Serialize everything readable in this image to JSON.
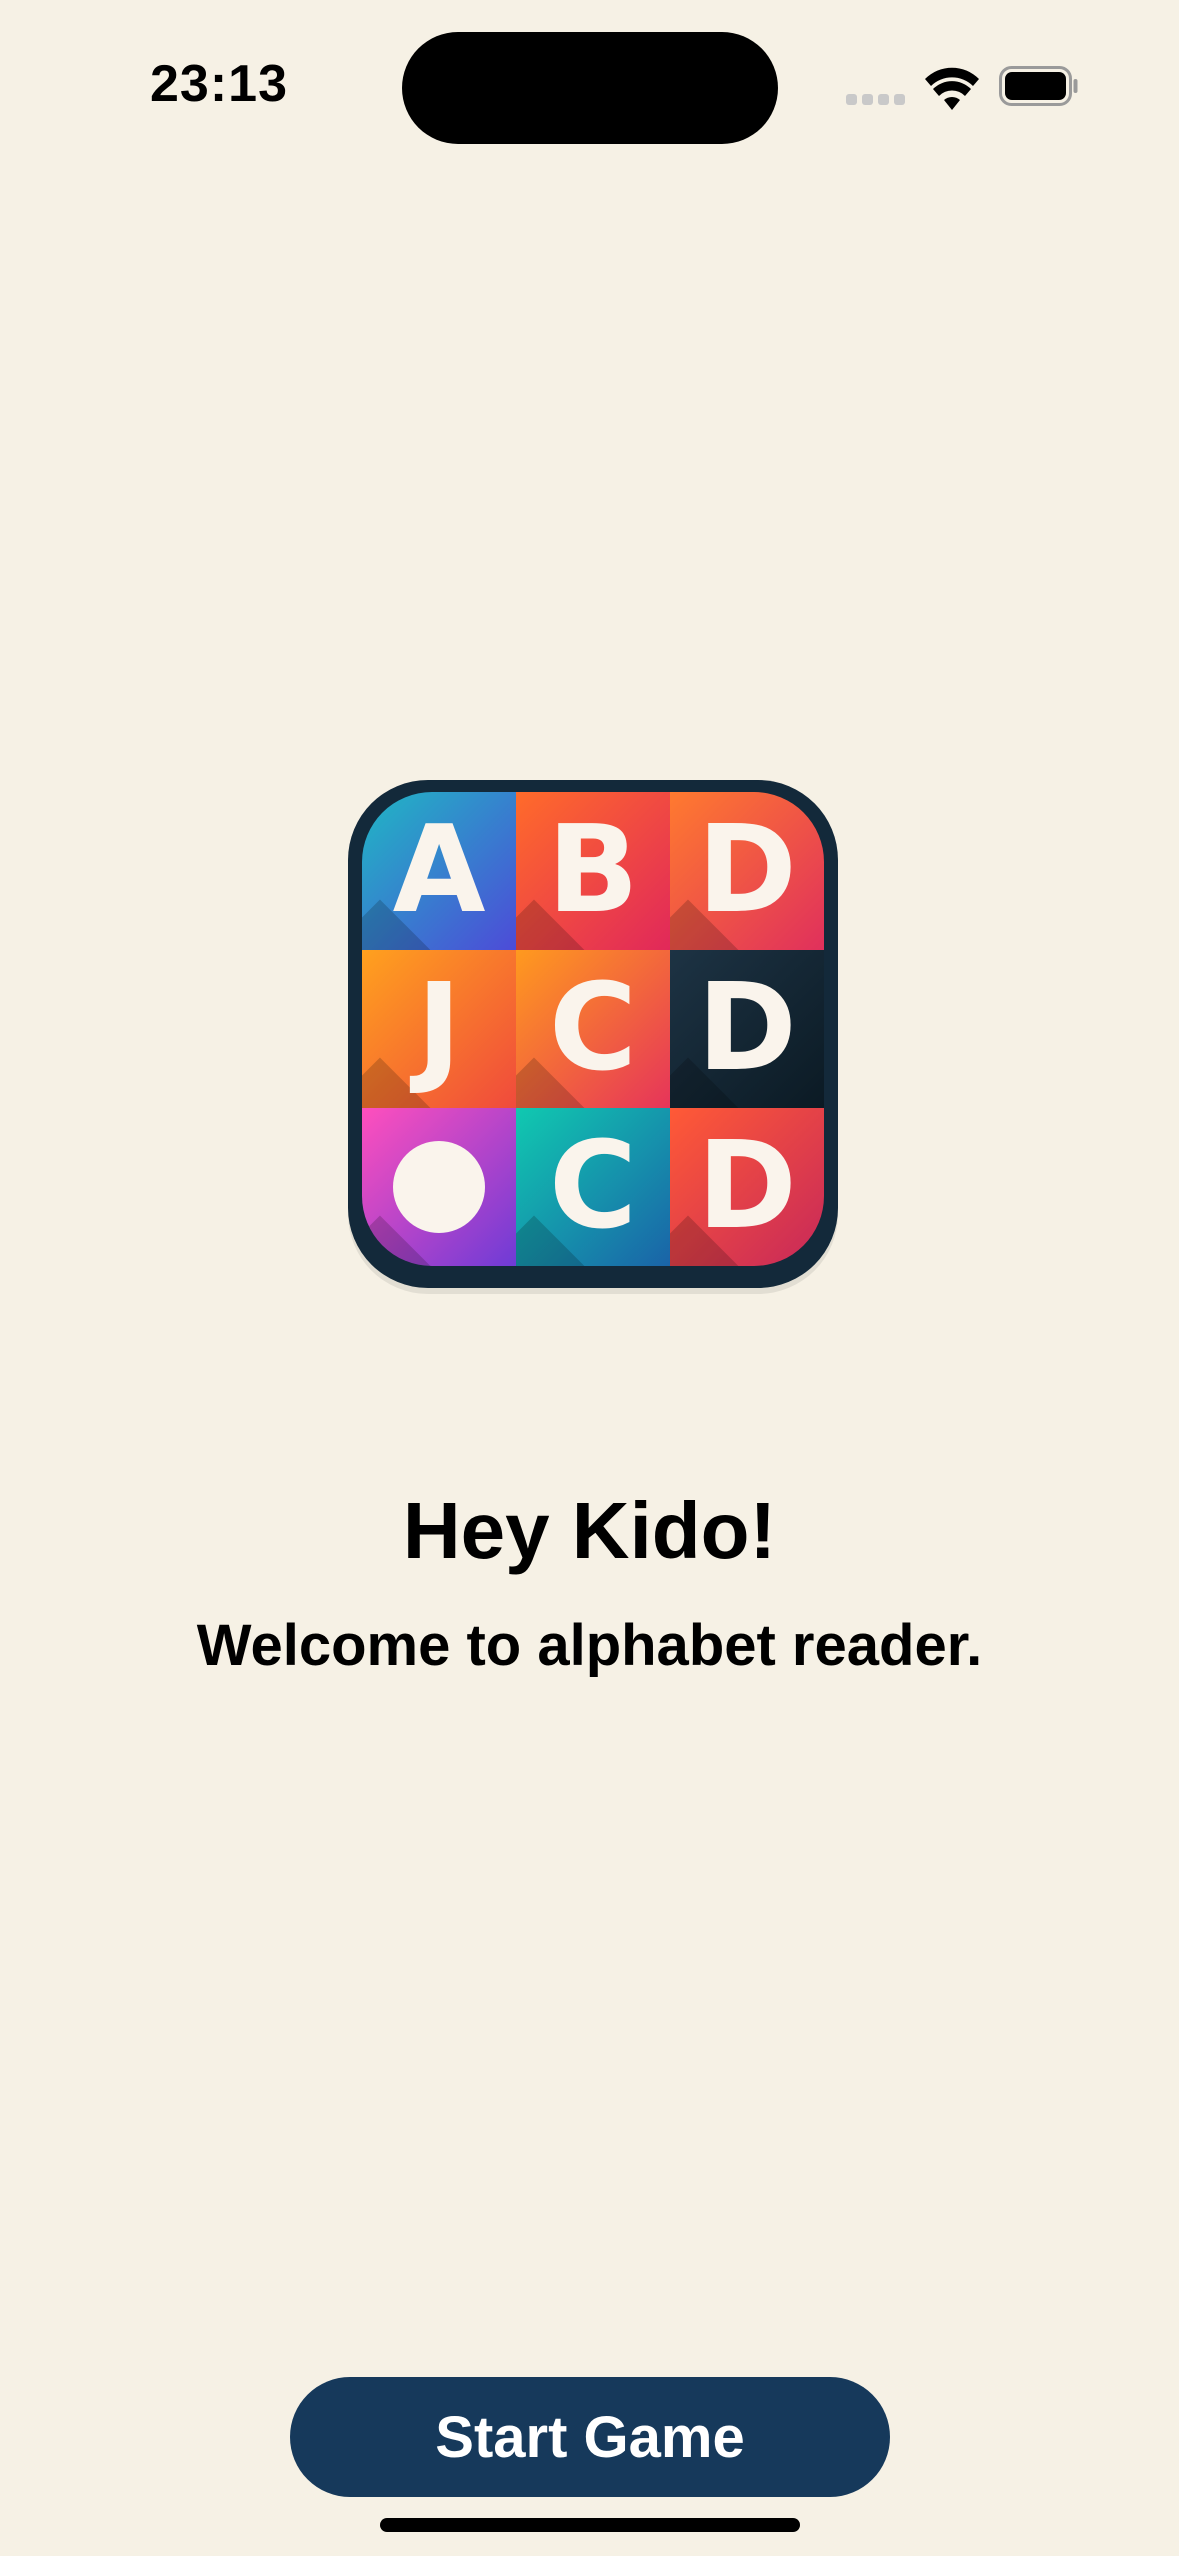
{
  "status_bar": {
    "time": "23:13",
    "icons": [
      "signal-icon",
      "wifi-icon",
      "battery-icon"
    ]
  },
  "app_icon": {
    "tiles": [
      {
        "letter": "A",
        "colors": [
          "#1FB8C4",
          "#4D4BD8"
        ]
      },
      {
        "letter": "B",
        "colors": [
          "#FF6B2A",
          "#E1285A"
        ]
      },
      {
        "letter": "D",
        "colors": [
          "#FF7A2F",
          "#E0305C"
        ]
      },
      {
        "letter": "J",
        "colors": [
          "#FFA11E",
          "#F04A3C"
        ]
      },
      {
        "letter": "C",
        "colors": [
          "#FF9A1E",
          "#E6345A"
        ]
      },
      {
        "letter": "D",
        "colors": [
          "#1D3344",
          "#0B1A24"
        ]
      },
      {
        "letter": "",
        "colors": [
          "#FF4FBD",
          "#6E3BD6"
        ]
      },
      {
        "letter": "C",
        "colors": [
          "#10C9B0",
          "#1A63A8"
        ]
      },
      {
        "letter": "D",
        "colors": [
          "#FF5A36",
          "#C7285A"
        ]
      }
    ],
    "frame_color": "#13293A"
  },
  "greeting": "Hey Kido!",
  "subtitle": "Welcome to alphabet reader.",
  "start_button": {
    "label": "Start Game",
    "color": "#16395B"
  },
  "colors": {
    "background": "#F6F1E5"
  }
}
